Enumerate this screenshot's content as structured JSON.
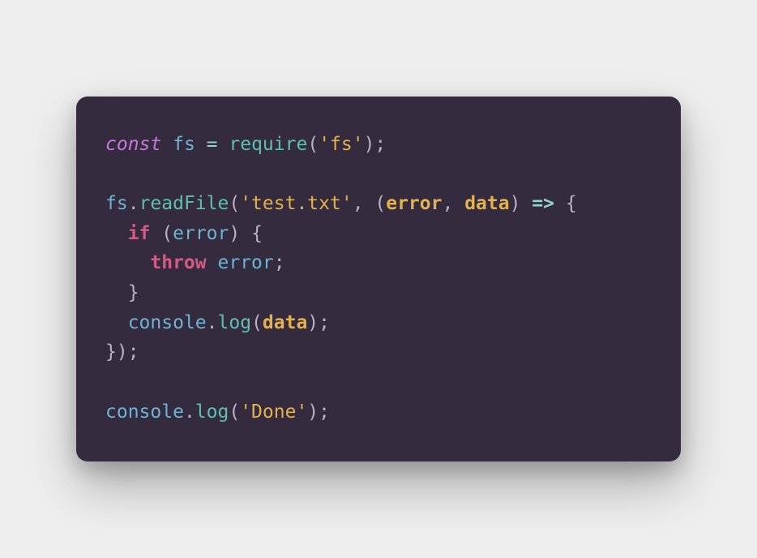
{
  "colors": {
    "background": "#eeeeee",
    "card": "#342b3e",
    "keyword": "#c678dd",
    "keyword_bold": "#d45c84",
    "identifier": "#6fb3d2",
    "operator": "#92d6c9",
    "function": "#5fbfb0",
    "punctuation": "#b9b2c4",
    "string": "#e3b24c",
    "param": "#e3b24c",
    "arrow": "#92d6c9"
  },
  "code": {
    "lines": [
      [
        {
          "cls": "kw",
          "text": "const"
        },
        {
          "cls": "",
          "text": " "
        },
        {
          "cls": "ident",
          "text": "fs"
        },
        {
          "cls": "",
          "text": " "
        },
        {
          "cls": "op",
          "text": "="
        },
        {
          "cls": "",
          "text": " "
        },
        {
          "cls": "fn",
          "text": "require"
        },
        {
          "cls": "punct",
          "text": "("
        },
        {
          "cls": "str",
          "text": "'fs'"
        },
        {
          "cls": "punct",
          "text": ");"
        }
      ],
      [],
      [
        {
          "cls": "ident",
          "text": "fs"
        },
        {
          "cls": "punct",
          "text": "."
        },
        {
          "cls": "fn",
          "text": "readFile"
        },
        {
          "cls": "punct",
          "text": "("
        },
        {
          "cls": "str",
          "text": "'test.txt'"
        },
        {
          "cls": "punct",
          "text": ", ("
        },
        {
          "cls": "param",
          "text": "error"
        },
        {
          "cls": "punct",
          "text": ", "
        },
        {
          "cls": "param",
          "text": "data"
        },
        {
          "cls": "punct",
          "text": ") "
        },
        {
          "cls": "arrow",
          "text": "=>"
        },
        {
          "cls": "punct",
          "text": " {"
        }
      ],
      [
        {
          "cls": "",
          "text": "  "
        },
        {
          "cls": "pw",
          "text": "if"
        },
        {
          "cls": "",
          "text": " "
        },
        {
          "cls": "punct",
          "text": "("
        },
        {
          "cls": "ident",
          "text": "error"
        },
        {
          "cls": "punct",
          "text": ") {"
        }
      ],
      [
        {
          "cls": "",
          "text": "    "
        },
        {
          "cls": "pw",
          "text": "throw"
        },
        {
          "cls": "",
          "text": " "
        },
        {
          "cls": "ident",
          "text": "error"
        },
        {
          "cls": "punct",
          "text": ";"
        }
      ],
      [
        {
          "cls": "",
          "text": "  "
        },
        {
          "cls": "punct",
          "text": "}"
        }
      ],
      [
        {
          "cls": "",
          "text": "  "
        },
        {
          "cls": "ident",
          "text": "console"
        },
        {
          "cls": "punct",
          "text": "."
        },
        {
          "cls": "fn",
          "text": "log"
        },
        {
          "cls": "punct",
          "text": "("
        },
        {
          "cls": "param",
          "text": "data"
        },
        {
          "cls": "punct",
          "text": ");"
        }
      ],
      [
        {
          "cls": "punct",
          "text": "});"
        }
      ],
      [],
      [
        {
          "cls": "ident",
          "text": "console"
        },
        {
          "cls": "punct",
          "text": "."
        },
        {
          "cls": "fn",
          "text": "log"
        },
        {
          "cls": "punct",
          "text": "("
        },
        {
          "cls": "str",
          "text": "'Done'"
        },
        {
          "cls": "punct",
          "text": ");"
        }
      ]
    ]
  }
}
